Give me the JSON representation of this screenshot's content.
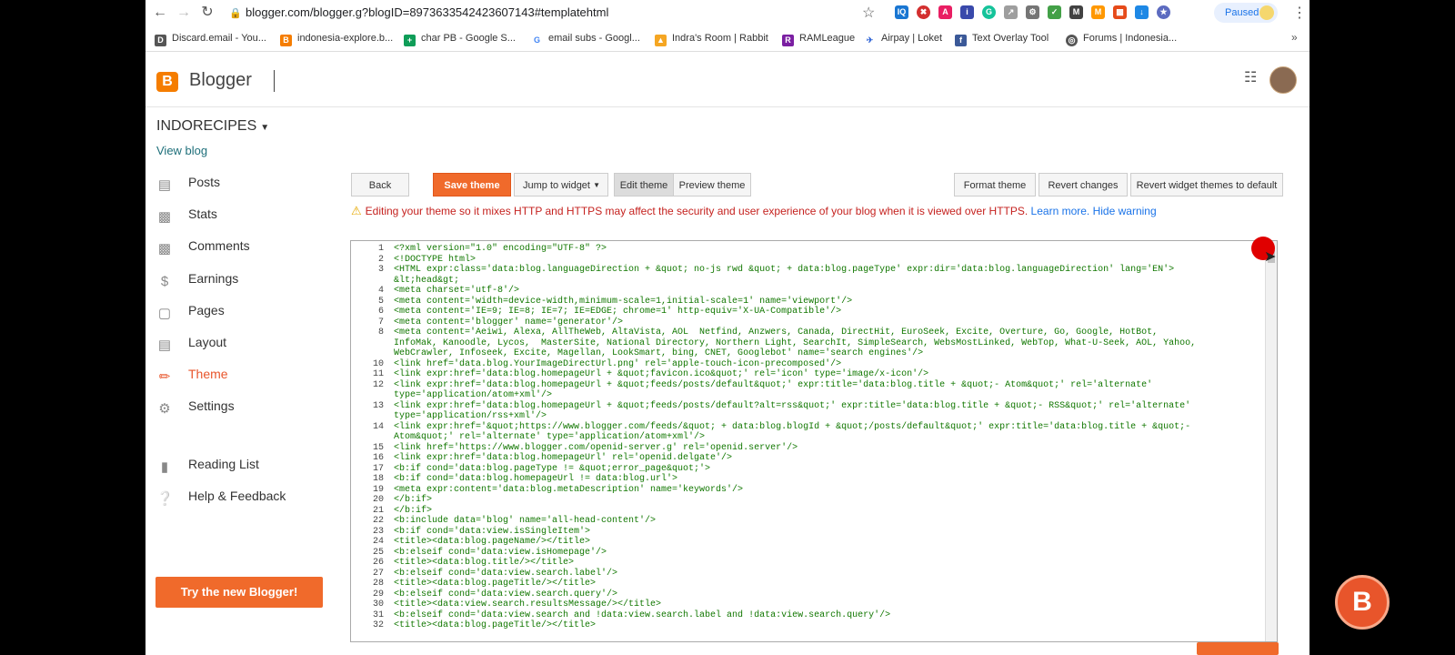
{
  "browser": {
    "url": "blogger.com/blogger.g?blogID=8973633542423607143#templatehtml",
    "paused_label": "Paused"
  },
  "bookmarks": [
    {
      "label": "Discard.email - You...",
      "icon": "discard-icon",
      "color": "#555555"
    },
    {
      "label": "indonesia-explore.b...",
      "icon": "blogger-icon",
      "color": "#f57d00"
    },
    {
      "label": "char PB - Google S...",
      "icon": "sheets-icon",
      "color": "#0f9d58"
    },
    {
      "label": "email subs - Googl...",
      "icon": "google-icon",
      "color": "#4285f4"
    },
    {
      "label": "Indra's Room | Rabbit",
      "icon": "rabbit-icon",
      "color": "#f5a623"
    },
    {
      "label": "RAMLeague",
      "icon": "ramleague-icon",
      "color": "#7b1fa2"
    },
    {
      "label": "Airpay | Loket",
      "icon": "airpay-icon",
      "color": "#3367d6"
    },
    {
      "label": "Text Overlay Tool",
      "icon": "facebook-icon",
      "color": "#3b5998"
    },
    {
      "label": "Forums | Indonesia...",
      "icon": "forum-icon",
      "color": "#555555"
    }
  ],
  "blogger": {
    "title": "Blogger",
    "blog_name": "INDORECIPES",
    "view_blog": "View blog"
  },
  "sidebar": {
    "items": [
      {
        "label": "Posts",
        "icon": "posts-icon"
      },
      {
        "label": "Stats",
        "icon": "stats-icon"
      },
      {
        "label": "Comments",
        "icon": "comments-icon"
      },
      {
        "label": "Earnings",
        "icon": "earnings-icon"
      },
      {
        "label": "Pages",
        "icon": "pages-icon"
      },
      {
        "label": "Layout",
        "icon": "layout-icon"
      },
      {
        "label": "Theme",
        "icon": "theme-icon",
        "active": true
      },
      {
        "label": "Settings",
        "icon": "settings-icon"
      },
      {
        "label": "Reading List",
        "icon": "reading-list-icon"
      },
      {
        "label": "Help & Feedback",
        "icon": "help-icon"
      }
    ],
    "try_new": "Try the new Blogger!"
  },
  "toolbar": {
    "back": "Back",
    "save_theme": "Save theme",
    "jump_to_widget": "Jump to widget",
    "edit_theme": "Edit theme",
    "preview_theme": "Preview theme",
    "format_theme": "Format theme",
    "revert_changes": "Revert changes",
    "revert_widgets": "Revert widget themes to default"
  },
  "warning": {
    "text": "Editing your theme so it mixes HTTP and HTTPS may affect the security and user experience of your blog when it is viewed over HTTPS.",
    "learn_more": "Learn more.",
    "hide": "Hide warning"
  },
  "editor": {
    "lines": [
      {
        "n": "1",
        "text": "<?xml version=\"1.0\" encoding=\"UTF-8\" ?>"
      },
      {
        "n": "2",
        "text": "<!DOCTYPE html>"
      },
      {
        "n": "3",
        "text": "<HTML expr:class='data:blog.languageDirection + &quot; no-js rwd &quot; + data:blog.pageType' expr:dir='data:blog.languageDirection' lang='EN'>"
      },
      {
        "n": "",
        "text": "&lt;head&gt;"
      },
      {
        "n": "4",
        "text": "<meta charset='utf-8'/>"
      },
      {
        "n": "5",
        "text": "<meta content='width=device-width,minimum-scale=1,initial-scale=1' name='viewport'/>"
      },
      {
        "n": "6",
        "text": "<meta content='IE=9; IE=8; IE=7; IE=EDGE; chrome=1' http-equiv='X-UA-Compatible'/>"
      },
      {
        "n": "7",
        "text": "<meta content='blogger' name='generator'/>"
      },
      {
        "n": "8",
        "text": "<meta content='Aeiwi, Alexa, AllTheWeb, AltaVista, AOL  Netfind, Anzwers, Canada, DirectHit, EuroSeek, Excite, Overture, Go, Google, HotBot,"
      },
      {
        "n": "",
        "text": "InfoMak, Kanoodle, Lycos,  MasterSite, National Directory, Northern Light, SearchIt, SimpleSearch, WebsMostLinked, WebTop, What-U-Seek, AOL, Yahoo,"
      },
      {
        "n": "",
        "text": "WebCrawler, Infoseek, Excite, Magellan, LookSmart, bing, CNET, Googlebot' name='search engines'/>"
      },
      {
        "n": "10",
        "text": "<link href='data.blog.YourImageDirectUrl.png' rel='apple-touch-icon-precomposed'/>"
      },
      {
        "n": "11",
        "text": "<link expr:href='data:blog.homepageUrl + &quot;favicon.ico&quot;' rel='icon' type='image/x-icon'/>"
      },
      {
        "n": "12",
        "text": "<link expr:href='data:blog.homepageUrl + &quot;feeds/posts/default&quot;' expr:title='data:blog.title + &quot;- Atom&quot;' rel='alternate'"
      },
      {
        "n": "",
        "text": "type='application/atom+xml'/>"
      },
      {
        "n": "13",
        "text": "<link expr:href='data:blog.homepageUrl + &quot;feeds/posts/default?alt=rss&quot;' expr:title='data:blog.title + &quot;- RSS&quot;' rel='alternate'"
      },
      {
        "n": "",
        "text": "type='application/rss+xml'/>"
      },
      {
        "n": "14",
        "text": "<link expr:href='&quot;https://www.blogger.com/feeds/&quot; + data:blog.blogId + &quot;/posts/default&quot;' expr:title='data:blog.title + &quot;-"
      },
      {
        "n": "",
        "text": "Atom&quot;' rel='alternate' type='application/atom+xml'/>"
      },
      {
        "n": "15",
        "text": "<link href='https://www.blogger.com/openid-server.g' rel='openid.server'/>"
      },
      {
        "n": "16",
        "text": "<link expr:href='data:blog.homepageUrl' rel='openid.delgate'/>"
      },
      {
        "n": "17",
        "text": "<b:if cond='data:blog.pageType != &quot;error_page&quot;'>"
      },
      {
        "n": "18",
        "text": "<b:if cond='data:blog.homepageUrl != data:blog.url'>"
      },
      {
        "n": "19",
        "text": "<meta expr:content='data:blog.metaDescription' name='keywords'/>"
      },
      {
        "n": "20",
        "text": "</b:if>"
      },
      {
        "n": "21",
        "text": "</b:if>"
      },
      {
        "n": "22",
        "text": "<b:include data='blog' name='all-head-content'/>"
      },
      {
        "n": "23",
        "text": "<b:if cond='data:view.isSingleItem'>"
      },
      {
        "n": "24",
        "text": "<title><data:blog.pageName/></title>"
      },
      {
        "n": "25",
        "text": "<b:elseif cond='data:view.isHomepage'/>"
      },
      {
        "n": "26",
        "text": "<title><data:blog.title/></title>"
      },
      {
        "n": "27",
        "text": "<b:elseif cond='data:view.search.label'/>"
      },
      {
        "n": "28",
        "text": "<title><data:blog.pageTitle/></title>"
      },
      {
        "n": "29",
        "text": "<b:elseif cond='data:view.search.query'/>"
      },
      {
        "n": "30",
        "text": "<title><data:view.search.resultsMessage/></title>"
      },
      {
        "n": "31",
        "text": "<b:elseif cond='data:view.search and !data:view.search.label and !data:view.search.query'/>"
      },
      {
        "n": "32",
        "text": "<title><data:blog.pageTitle/></title>"
      }
    ]
  },
  "floating_logo": "B"
}
